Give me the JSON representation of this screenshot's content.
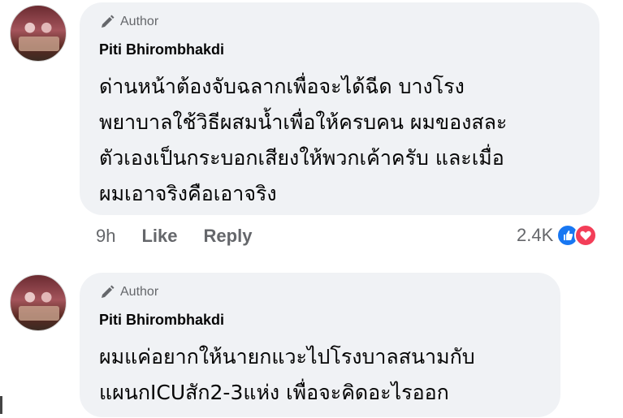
{
  "comments": [
    {
      "author_label": "Author",
      "name": "Piti Bhirombhakdi",
      "lines": [
        "ด่านหน้าต้องจับฉลากเพื่อจะได้ฉีด บางโรง",
        "พยาบาลใช้วิธีผสมน้ำเพื่อให้ครบคน ผมของสละ",
        "ตัวเองเป็นกระบอกเสียงให้พวกเค้าครับ และเมื่อ",
        "ผมเอาจริงคือเอาจริง"
      ],
      "time": "9h",
      "like_label": "Like",
      "reply_label": "Reply",
      "reaction_count": "2.4K",
      "reactions": [
        "like-icon",
        "love-icon"
      ]
    },
    {
      "author_label": "Author",
      "name": "Piti Bhirombhakdi",
      "lines": [
        "ผมแค่อยากให้นายกแวะไปโรงบาลสนามกับ",
        "แผนกICUสัก2-3แห่ง เพื่อจะคิดอะไรออก"
      ]
    }
  ],
  "colors": {
    "bubble": "#f0f2f5",
    "secondary_text": "#65676b",
    "like_blue": "#1877f2",
    "love_red": "#f33e58"
  }
}
